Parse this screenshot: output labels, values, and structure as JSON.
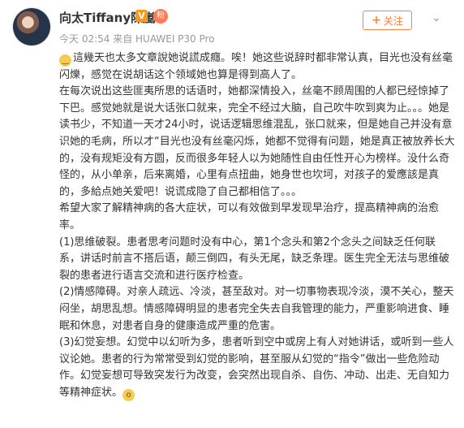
{
  "user": {
    "name": "向太Tiffany陳嵐",
    "verified_badge": "V",
    "fan_badge": "粉"
  },
  "meta": {
    "time_text": "今天 02:54 来自 HUAWEI P30 Pro"
  },
  "follow_button": {
    "plus": "+",
    "label": "关注"
  },
  "menu_icon": "chevron-down-icon",
  "post": {
    "emoji_start": "😟",
    "emoji_end": "😱",
    "paragraphs": [
      "這幾天也太多文章說她说謊成癮。唉！她这些说辞时都非常认真，目光也没有丝毫闪爍，感觉在说胡话这个领域她也算是得到高人了。",
      "在每次说出这些匪夷所思的话语时，她都深情投入，丝毫不顾周围的人都已经惊掉了下巴。感觉她就是说大话张口就来，完全不经过大脑，自己吹牛吹到爽为止。。。她是读书少，不知道一天才24小时，说话逻辑思维混乱，张口就来，但是她自己并没有意识她的毛病，所以才“目光也没有丝毫闪烁，她都不觉得有问题，她是真正被放养长大的，没有规矩没有方圆，反而很多年轻人以为她随性自由任性开心为榜样。没什么奇怪的，从小单亲，后来离婚，心里有点扭曲，她身世也坎坷，对孩子的爱應該是真的，多給点她关爱吧！说谎成隐了自己都相信了。。。",
      "希望大家了解精神病的各大症状，可以有效做到早发现早治疗，提高精神病的治愈率。",
      "(1)思维破裂。患者思考问题时没有中心，第1个念头和第2个念头之间缺乏任何联系，讲话时前言不搭后语，颠三倒四，有头无尾，缺乏条理。医生完全无法与思维破裂的患者进行语言交流和进行医疗检查。",
      "(2)情感障碍。对亲人疏远、冷淡，甚至敌对。对一切事物表现冷淡，漠不关心，整天闷坐，胡思乱想。情感障碍明显的患者完全失去自我管理的能力，严重影响进食、睡眠和休息，对患者自身的健康造成严重的危害。",
      "(3)幻觉妄想。幻觉中以幻听为多，患者听到空中或房上有人对她讲话，或听到一些人议论她。患者的行为常常受到幻觉的影响，甚至服从幻觉的“指令”做出一些危险动作。幻觉妄想可导致突发行为改变，会突然出现自杀、自伤、冲动、出走、无自知力等精神症状。"
    ]
  }
}
